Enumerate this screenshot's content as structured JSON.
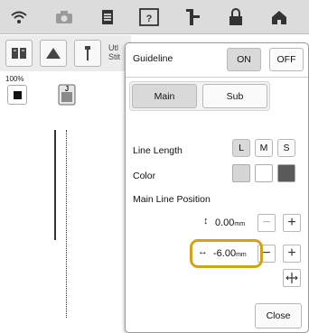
{
  "toolbar": {
    "icons": [
      "wifi-icon",
      "camera-icon",
      "document-icon",
      "help-icon",
      "thread-icon",
      "lock-icon",
      "home-icon"
    ]
  },
  "subrow": {
    "util_text_1": "Utl",
    "util_text_2": "Stit"
  },
  "preview": {
    "zoom": "100%",
    "foot_label": "J"
  },
  "panel": {
    "title": "Guideline",
    "on_label": "ON",
    "off_label": "OFF",
    "tabs": [
      {
        "label": "Main"
      },
      {
        "label": "Sub"
      }
    ],
    "line_length": {
      "label": "Line Length",
      "options": [
        "L",
        "M",
        "S"
      ]
    },
    "color": {
      "label": "Color"
    },
    "main_line_position": {
      "label": "Main Line Position",
      "vertical": {
        "value": "0.00",
        "unit": "mm"
      },
      "horizontal": {
        "value": "-6.00",
        "unit": "mm"
      }
    },
    "close_label": "Close"
  },
  "colors": {
    "highlight": "#d2a21a",
    "swatch_light": "#d6d6d6",
    "swatch_white": "#ffffff",
    "swatch_dark": "#5a5a5a"
  }
}
